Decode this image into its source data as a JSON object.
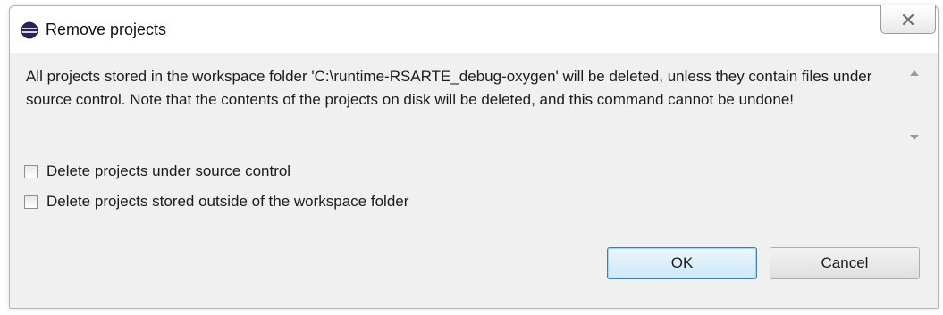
{
  "dialog": {
    "title": "Remove projects",
    "close_glyph": "✕",
    "message": "All projects stored in the workspace folder 'C:\\runtime-RSARTE_debug-oxygen' will be deleted, unless they contain files under source control. Note that the contents of the projects on disk will be deleted, and this command cannot be undone!",
    "options": [
      {
        "label": "Delete projects under source control",
        "checked": false
      },
      {
        "label": "Delete projects stored outside of the workspace folder",
        "checked": false
      }
    ],
    "ok_label": "OK",
    "cancel_label": "Cancel"
  },
  "icons": {
    "app": "eclipse-icon",
    "close": "close-icon"
  },
  "colors": {
    "dialog_bg": "#f0f0f0",
    "titlebar_bg": "#ffffff",
    "ok_border": "#3c7fb1",
    "ok_bg": "#cde8f8"
  }
}
